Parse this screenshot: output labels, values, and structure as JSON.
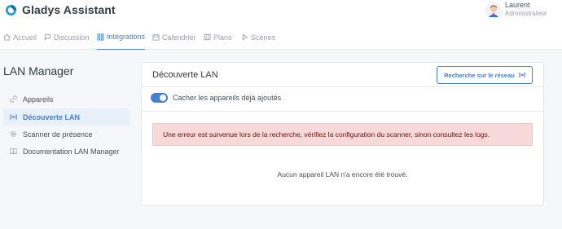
{
  "brand": {
    "name": "Gladys Assistant"
  },
  "user": {
    "name": "Laurent",
    "role": "Administrateur"
  },
  "nav": {
    "items": [
      {
        "label": "Accueil",
        "icon": "home-icon"
      },
      {
        "label": "Discussion",
        "icon": "message-icon"
      },
      {
        "label": "Intégrations",
        "icon": "grid-icon",
        "active": true
      },
      {
        "label": "Calendrier",
        "icon": "calendar-icon"
      },
      {
        "label": "Plans",
        "icon": "map-icon"
      },
      {
        "label": "Scènes",
        "icon": "play-icon"
      }
    ]
  },
  "sidebar": {
    "title": "LAN Manager",
    "items": [
      {
        "label": "Appareils",
        "icon": "link-icon"
      },
      {
        "label": "Découverte LAN",
        "icon": "radio-icon",
        "active": true
      },
      {
        "label": "Scanner de présence",
        "icon": "settings-icon"
      },
      {
        "label": "Documentation LAN Manager",
        "icon": "book-icon"
      }
    ]
  },
  "card": {
    "title": "Découverte LAN",
    "scan_button": "Recherche sur le réseau",
    "toggle_label": "Cacher les appareils déjà ajoutés",
    "toggle_on": true,
    "error": "Une erreur est survenue lors de la recherche, vérifiez la configuration du scanner, sinon consultez les logs.",
    "empty": "Aucun appareil LAN n'a encore été trouvé."
  },
  "colors": {
    "accent": "#467fcf",
    "alert_bg": "#f6d9d8",
    "alert_text": "#6b1110"
  }
}
